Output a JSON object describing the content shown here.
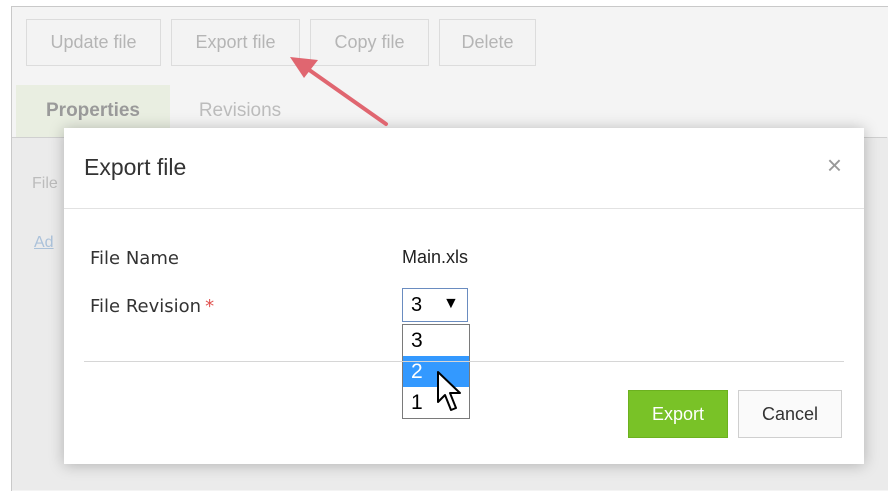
{
  "toolbar": {
    "update_label": "Update file",
    "export_label": "Export file",
    "copy_label": "Copy file",
    "delete_label": "Delete"
  },
  "tabs": [
    {
      "label": "Properties"
    },
    {
      "label": "Revisions"
    }
  ],
  "background": {
    "partial_label": "File",
    "partial_link": "Ad"
  },
  "dialog": {
    "title": "Export file",
    "close_glyph": "×",
    "file_name_label": "File Name",
    "file_name_value": "Main.xls",
    "revision_label": "File Revision",
    "required_mark": "*",
    "selected_revision": "3",
    "caret_glyph": "▼",
    "revision_options": [
      "3",
      "2",
      "1"
    ],
    "export_button": "Export",
    "cancel_button": "Cancel"
  },
  "colors": {
    "accent_green": "#79c227",
    "highlight_blue": "#3399ff",
    "annotation_arrow": "#e06670"
  }
}
